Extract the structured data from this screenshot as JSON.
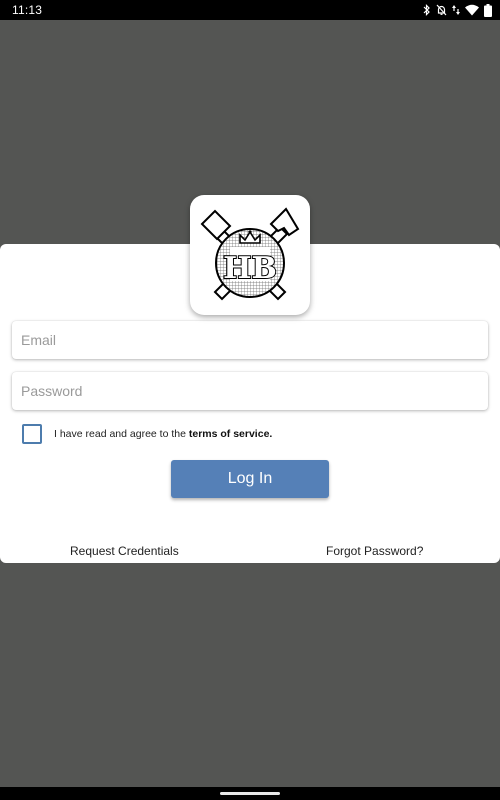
{
  "status_bar": {
    "time": "11:13",
    "icons": [
      "bluetooth-icon",
      "notifications-off-icon",
      "data-arrows-icon",
      "wifi-icon",
      "battery-icon"
    ]
  },
  "logo": {
    "monogram": "HB",
    "icon": "crossed-hammers-crest-logo"
  },
  "login_form": {
    "email_placeholder": "Email",
    "email_value": "",
    "password_placeholder": "Password",
    "password_value": "",
    "terms_prefix": "I have read and agree to the ",
    "terms_link": "terms of service.",
    "terms_checked": false,
    "login_label": "Log In"
  },
  "footer": {
    "request_credentials": "Request Credentials",
    "forgot_password": "Forgot Password?"
  },
  "colors": {
    "backdrop": "#545553",
    "accent": "#5580b7",
    "checkbox_border": "#4d7cad"
  }
}
